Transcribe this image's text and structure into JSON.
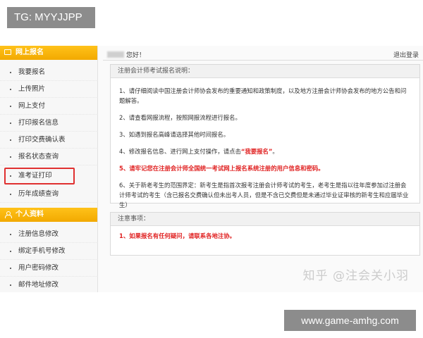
{
  "watermark_top": "TG: MYYJJPP",
  "watermark_bottom": "www.game-amhg.com",
  "sidebar": {
    "sections": [
      {
        "title": "网上报名",
        "items": [
          "我要报名",
          "上传照片",
          "网上支付",
          "打印报名信息",
          "打印交费确认表",
          "报名状态查询",
          "准考证打印",
          "历年成绩查询"
        ]
      },
      {
        "title": "个人资料",
        "items": [
          "注册信息修改",
          "绑定手机号修改",
          "用户密码修改",
          "邮件地址修改"
        ]
      }
    ]
  },
  "header": {
    "greeting": "您好！",
    "logout": "退出登录"
  },
  "instructions": {
    "title": "注册会计师考试报名说明：",
    "items": [
      "1、请仔细阅读中国注册会计师协会发布的重要通知和政策制度，以及地方注册会计师协会发布的地方公告和问题解答。",
      "2、请查看网报流程，按照网报流程进行报名。",
      "3、如遇到报名高峰请选择其他时间报名。",
      "4、修改报名信息、进行网上支付操作，请点击",
      "5、请牢记您在注册会计师全国统一考试网上报名系统注册的用户信息和密码。",
      "6、关于新老考生的范围界定：新考生是指首次报考注册会计师考试的考生，老考生是指以往年度参加过注册会计师考试的考生（含已报名交费确认但未出考人员，但是不含已交费但是未通过毕业证审核的新考生和应届毕业生）"
    ],
    "item4_link": "“我要报名”",
    "item4_end": "。"
  },
  "notes": {
    "title": "注意事项：",
    "text": "1、如果报名有任何疑问，请联系各地注协。"
  },
  "zhihu_watermark": "知乎 @注会关小羽",
  "colors": {
    "section_header": "#f2a900",
    "highlight_border": "#e03030",
    "warning_text": "#e02020"
  }
}
